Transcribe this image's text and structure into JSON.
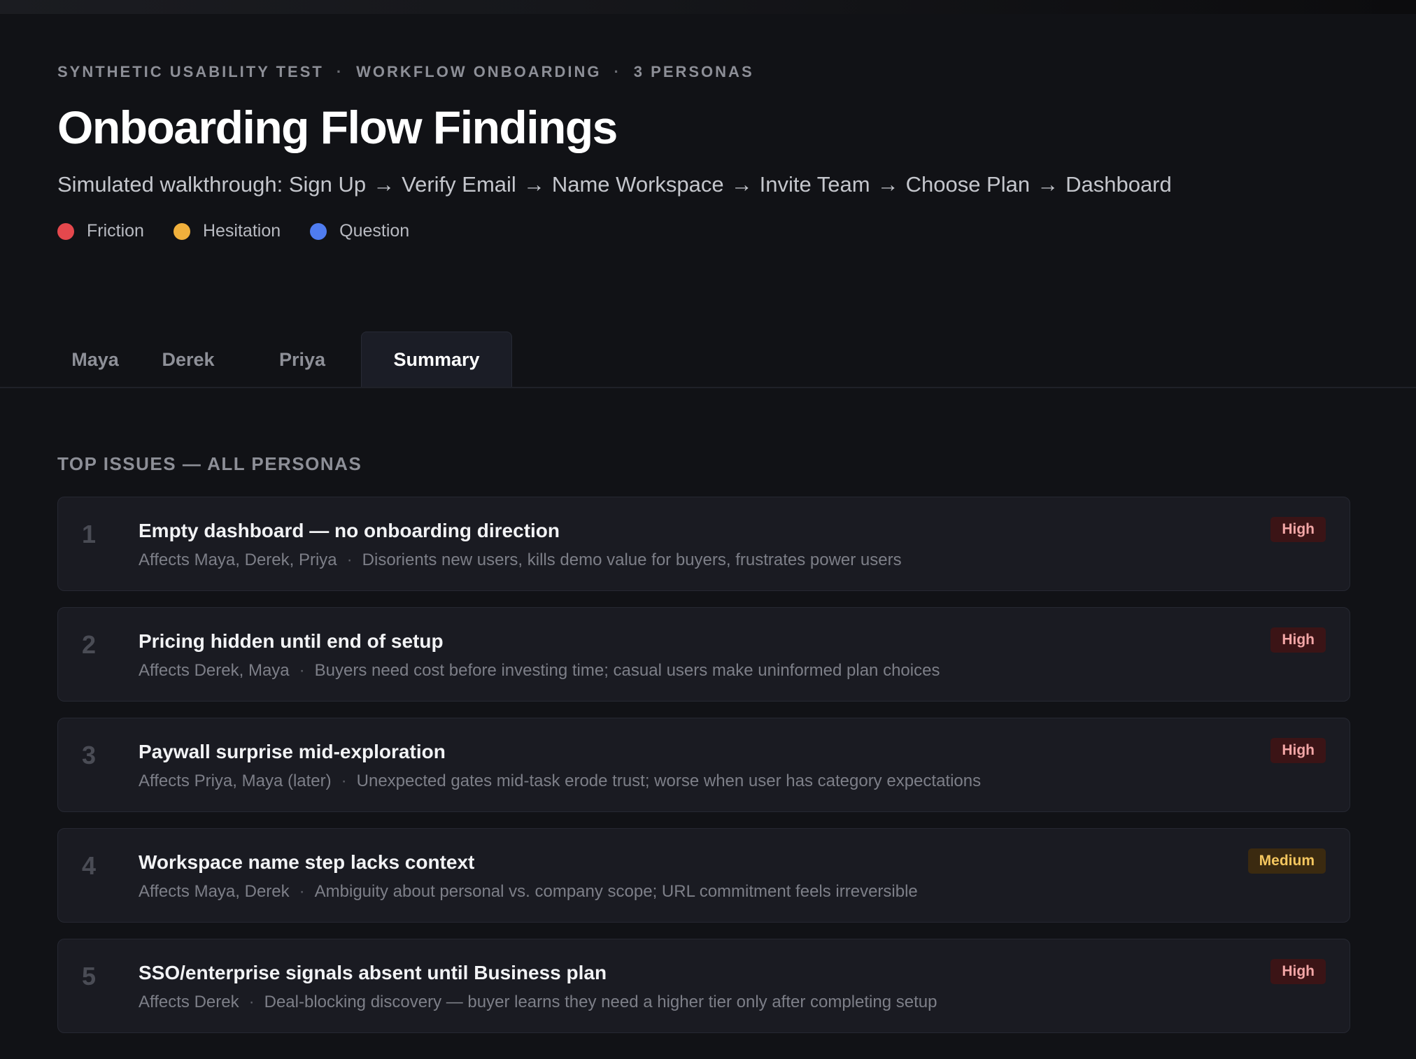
{
  "header": {
    "eyebrow": [
      "SYNTHETIC USABILITY TEST",
      "WORKFLOW ONBOARDING",
      "3 PERSONAS"
    ],
    "eyebrow_separator": "·",
    "title": "Onboarding Flow Findings",
    "subtitle_prefix": "Simulated walkthrough:",
    "flow_steps": [
      "Sign Up",
      "Verify Email",
      "Name Workspace",
      "Invite Team",
      "Choose Plan",
      "Dashboard"
    ],
    "flow_arrow": "→"
  },
  "legend": [
    {
      "label": "Friction",
      "color": "#e5484d"
    },
    {
      "label": "Hesitation",
      "color": "#f0b03c"
    },
    {
      "label": "Question",
      "color": "#4f7cf0"
    }
  ],
  "tabs": [
    {
      "label": "Maya",
      "active": false
    },
    {
      "label": "Derek",
      "active": false
    },
    {
      "label": "Priya",
      "active": false
    },
    {
      "label": "Summary",
      "active": true
    }
  ],
  "section": {
    "label": "TOP ISSUES — ALL PERSONAS"
  },
  "issues": [
    {
      "num": "1",
      "title": "Empty dashboard — no onboarding direction",
      "affects": "Affects Maya, Derek, Priya",
      "impact": "Disorients new users, kills demo value for buyers, frustrates power users",
      "severity": "High"
    },
    {
      "num": "2",
      "title": "Pricing hidden until end of setup",
      "affects": "Affects Derek, Maya",
      "impact": "Buyers need cost before investing time; casual users make uninformed plan choices",
      "severity": "High"
    },
    {
      "num": "3",
      "title": "Paywall surprise mid-exploration",
      "affects": "Affects Priya, Maya (later)",
      "impact": "Unexpected gates mid-task erode trust; worse when user has category expectations",
      "severity": "High"
    },
    {
      "num": "4",
      "title": "Workspace name step lacks context",
      "affects": "Affects Maya, Derek",
      "impact": "Ambiguity about personal vs. company scope; URL commitment feels irreversible",
      "severity": "Medium"
    },
    {
      "num": "5",
      "title": "SSO/enterprise signals absent until Business plan",
      "affects": "Affects Derek",
      "impact": "Deal-blocking discovery — buyer learns they need a higher tier only after completing setup",
      "severity": "High"
    }
  ],
  "meta_separator": "·"
}
